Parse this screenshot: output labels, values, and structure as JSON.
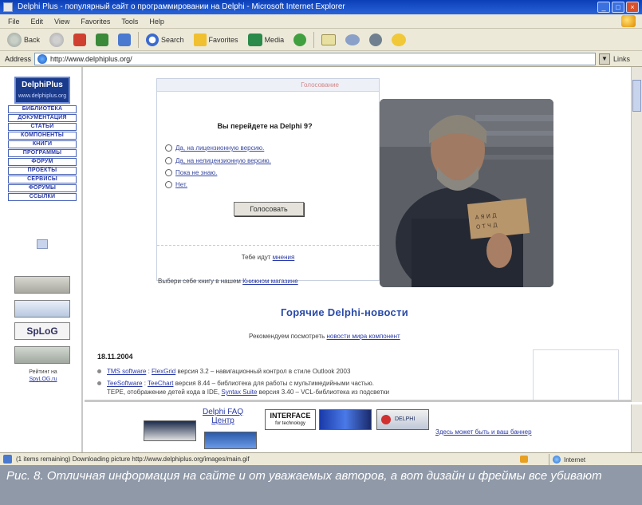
{
  "window": {
    "title": "Delphi Plus - популярный сайт о программировании на Delphi - Microsoft Internet Explorer"
  },
  "menubar": [
    "File",
    "Edit",
    "View",
    "Favorites",
    "Tools",
    "Help"
  ],
  "toolbar": {
    "back": "Back",
    "search": "Search",
    "favorites": "Favorites",
    "media": "Media"
  },
  "addressbar": {
    "label": "Address",
    "url": "http://www.delphiplus.org/",
    "links": "Links"
  },
  "sidebar": {
    "logo": "DelphiPlus",
    "logo_sub": "www.delphiplus.org",
    "items": [
      {
        "label": "БИБЛИОТЕКА"
      },
      {
        "label": "ДОКУМЕНТАЦИЯ"
      },
      {
        "label": "СТАТЬИ"
      },
      {
        "label": "КОМПОНЕНТЫ"
      },
      {
        "label": "КНИГИ"
      },
      {
        "label": "ПРОГРАММЫ"
      },
      {
        "label": "ФОРУМ"
      },
      {
        "label": "ПРОЕКТЫ"
      },
      {
        "label": "СЕРВИСЫ"
      },
      {
        "label": "ФОРУМЫ"
      },
      {
        "label": "ССЫЛКИ"
      }
    ],
    "banner3": "SpLoG",
    "counter_text": "Рейтинг на",
    "counter_link": "SpyLOG.ru"
  },
  "poll": {
    "header": "Голосование",
    "question": "Вы перейдете на Delphi 9?",
    "options": [
      "Да, на лицензионную версию.",
      "Да, на нелицензионную версию.",
      "Пока не знаю.",
      "Нет."
    ],
    "vote_button": "Голосовать",
    "footer_prefix": "Тебе идут",
    "footer_link": "мнения",
    "book_prefix": "Выбери себе книгу в нашем",
    "book_link": "Книжном магазине"
  },
  "news": {
    "title": "Горячие Delphi-новости",
    "reco_prefix": "Рекомендуем посмотреть",
    "reco_link": "новости мира компонент",
    "date": "18.11.2004",
    "items": [
      {
        "link": "TMS software",
        "link2": "FlexGrid",
        "text": "версия 3.2 – навигационный контрол в стиле Outlook 2003"
      },
      {
        "link": "TeeSoftware",
        "link2": "TeeChart",
        "text": "версия 8.44 – библиотека для работы с мультимедийными частью.",
        "text2": "ТЕРЕ, отображение детей кода в IDE,",
        "link3": "Syntax Suite",
        "text3": "версия 3.40 – VCL-библиотека из подсветки"
      }
    ]
  },
  "bottom": {
    "faq_link_1": "Delphi FAQ",
    "faq_link_2": "Центр",
    "bb3_text": "INTERFACE",
    "bb3_sub": "for technology",
    "bb5_text": "DELPHI",
    "ad_link": "Здесь может быть и ваш баннер"
  },
  "statusbar": {
    "text": "(1 items remaining) Downloading picture http://www.delphiplus.org/images/main.gif",
    "zone": "Internet"
  },
  "caption": {
    "text": "Рис. 8. Отличная информация на сайте и от уважаемых авторов, а вот дизайн и фреймы все убивают"
  },
  "colors": {
    "nav_text": "#2a3aa8",
    "caption_bg": "#8f99a8",
    "link": "#2a3aa8"
  }
}
